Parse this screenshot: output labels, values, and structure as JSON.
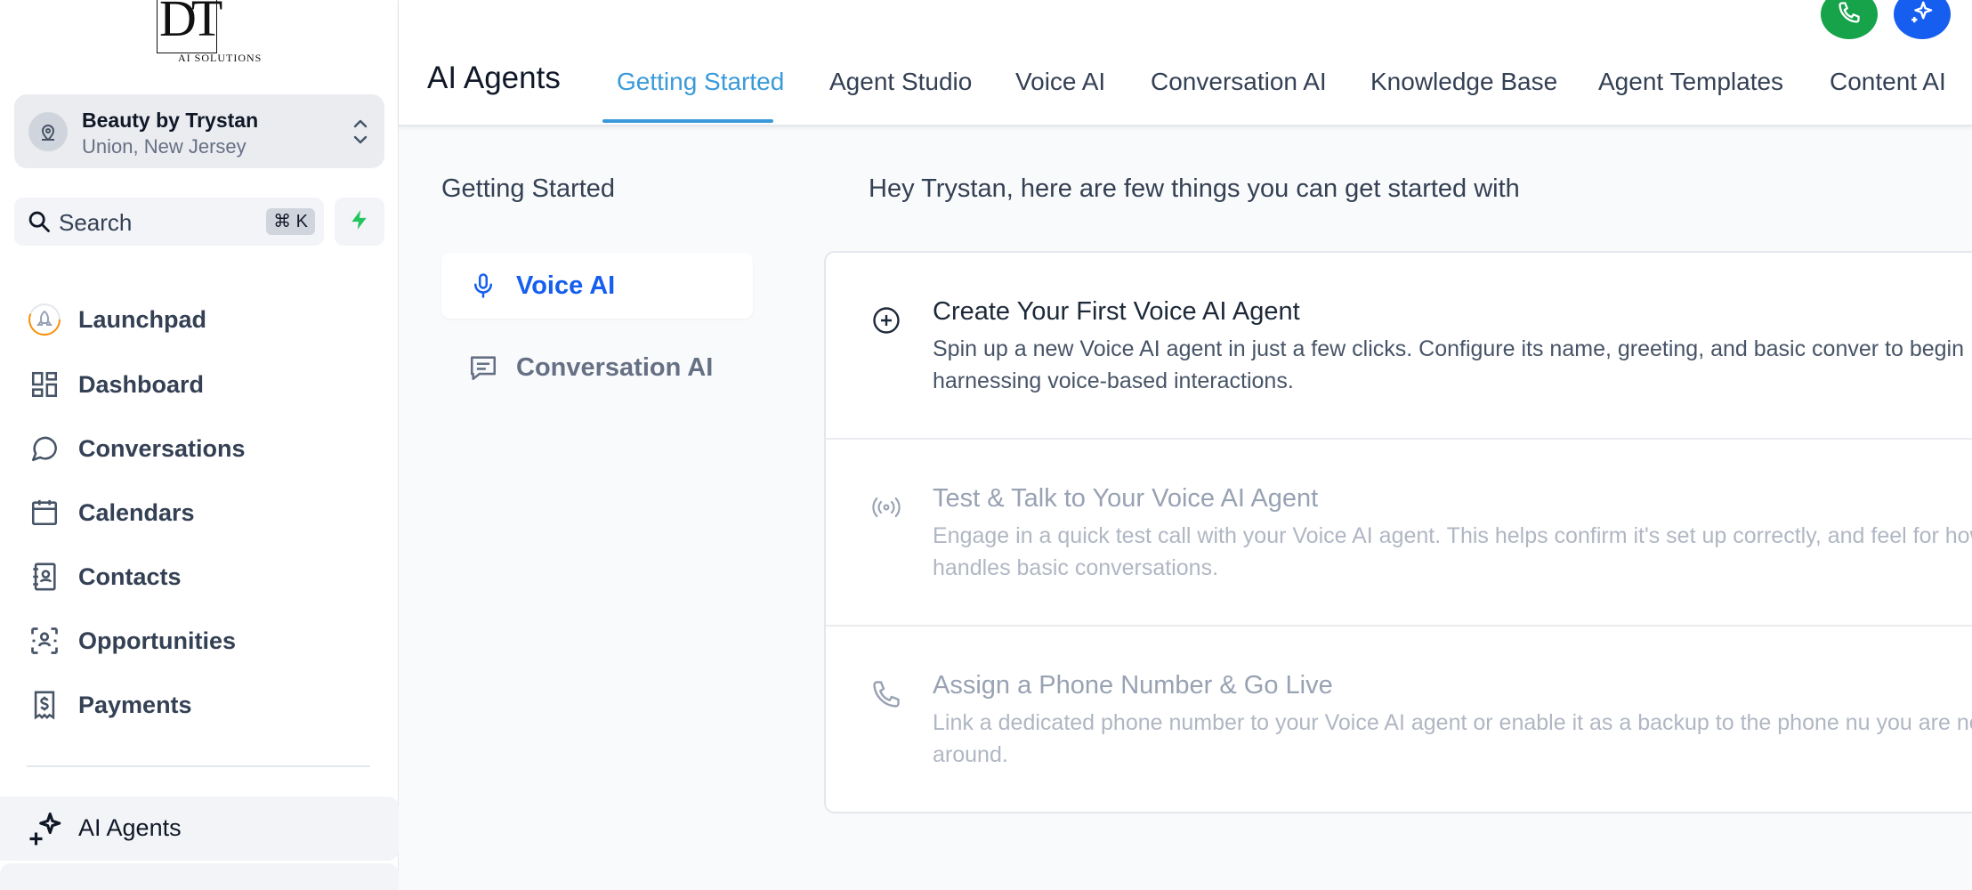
{
  "brand": {
    "logo_mark": "DT",
    "logo_sub": "AI SOLUTIONS"
  },
  "location": {
    "name": "Beauty by Trystan",
    "address": "Union, New Jersey"
  },
  "search": {
    "placeholder": "Search",
    "shortcut": "⌘ K"
  },
  "nav": {
    "items": [
      {
        "label": "Launchpad",
        "icon": "rocket-icon"
      },
      {
        "label": "Dashboard",
        "icon": "grid-icon"
      },
      {
        "label": "Conversations",
        "icon": "chat-bubble-icon"
      },
      {
        "label": "Calendars",
        "icon": "calendar-icon"
      },
      {
        "label": "Contacts",
        "icon": "contacts-book-icon"
      },
      {
        "label": "Opportunities",
        "icon": "opportunities-icon"
      },
      {
        "label": "Payments",
        "icon": "receipt-dollar-icon"
      }
    ],
    "active": {
      "label": "AI Agents",
      "icon": "sparkles-icon"
    }
  },
  "header": {
    "title": "AI Agents",
    "tabs": [
      {
        "label": "Getting Started",
        "active": true
      },
      {
        "label": "Agent Studio",
        "active": false
      },
      {
        "label": "Voice AI",
        "active": false
      },
      {
        "label": "Conversation AI",
        "active": false
      },
      {
        "label": "Knowledge Base",
        "active": false
      },
      {
        "label": "Agent Templates",
        "active": false
      },
      {
        "label": "Content AI",
        "active": false
      }
    ]
  },
  "sidebar_menu": {
    "heading": "Getting Started",
    "items": [
      {
        "label": "Voice AI",
        "icon": "microphone-icon",
        "active": true
      },
      {
        "label": "Conversation AI",
        "icon": "message-square-icon",
        "active": false
      }
    ]
  },
  "main": {
    "heading": "Hey Trystan, here are few things you can get started with",
    "steps": [
      {
        "title": "Create Your First Voice AI Agent",
        "description": "Spin up a new Voice AI agent in just a few clicks. Configure its name, greeting, and basic conver to begin harnessing voice-based interactions.",
        "icon": "plus-circle-icon",
        "state": "active"
      },
      {
        "title": "Test & Talk to Your Voice AI Agent",
        "description": "Engage in a quick test call with your Voice AI agent. This helps confirm it's set up correctly, and feel for how it handles basic conversations.",
        "icon": "broadcast-icon",
        "state": "muted"
      },
      {
        "title": "Assign a Phone Number & Go Live",
        "description": "Link a dedicated phone number to your Voice AI agent or enable it as a backup to the phone nu you are not around.",
        "icon": "phone-icon",
        "state": "muted"
      }
    ]
  },
  "colors": {
    "accent_tab": "#3a9ad9",
    "active_link": "#155eef",
    "call_button": "#16a34a",
    "ai_button": "#155eef",
    "quick_action": "#22c55e"
  }
}
